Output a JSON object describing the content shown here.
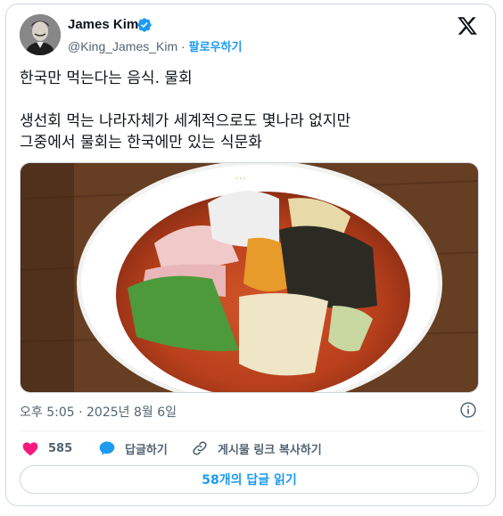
{
  "author": {
    "display_name": "James Kim",
    "handle": "@King_James_Kim",
    "separator": "·",
    "follow_label": "팔로우하기"
  },
  "tweet": {
    "line1": "한국만 먹는다는 음식. 물회",
    "line2": "생선회 먹는 나라자체가 세계적으로도 몇나라 없지만",
    "line3": "그중에서 물회는 한국에만 있는 식문화",
    "timestamp": "오후 5:05 · 2025년 8월 6일"
  },
  "actions": {
    "like_count": "585",
    "reply_label": "답글하기",
    "copy_link_label": "게시물 링크 복사하기"
  },
  "read_replies_label": "58개의 답글 읽기",
  "colors": {
    "accent": "#1d9bf0",
    "like": "#f91880",
    "muted": "#536471"
  },
  "icons": {
    "verified": "verified-badge-icon",
    "logo": "x-logo-icon",
    "like": "heart-icon",
    "reply": "speech-bubble-icon",
    "link": "link-icon",
    "info": "info-icon"
  }
}
